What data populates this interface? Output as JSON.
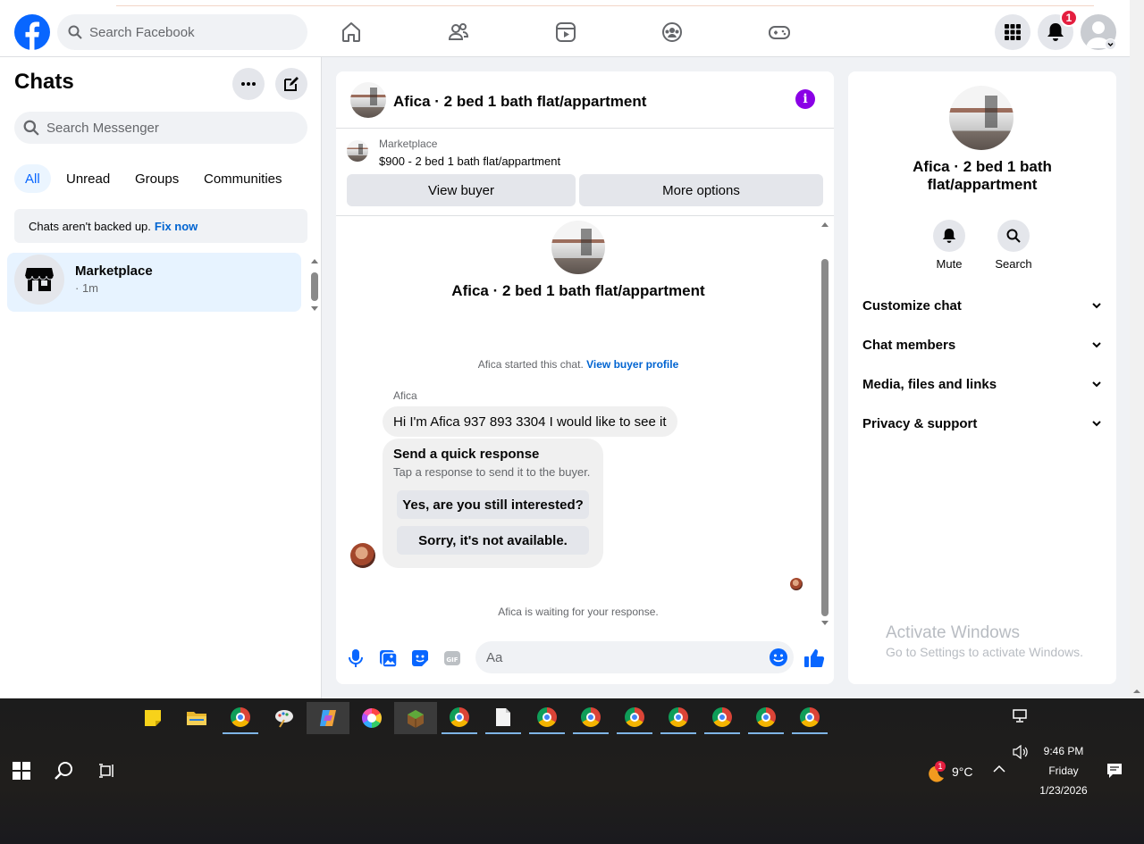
{
  "topbar": {
    "search_placeholder": "Search Facebook",
    "notification_count": "1",
    "nav_icons": [
      "home-icon",
      "friends-icon",
      "video-icon",
      "groups-icon",
      "gaming-icon"
    ]
  },
  "left": {
    "title": "Chats",
    "search_placeholder": "Search Messenger",
    "filters": [
      "All",
      "Unread",
      "Groups",
      "Communities"
    ],
    "active_filter": "All",
    "backup_text": "Chats aren't backed up.",
    "backup_link": "Fix now",
    "chat": {
      "name": "Marketplace",
      "time": "· 1m"
    }
  },
  "conversation": {
    "title": "Afica · 2 bed 1 bath flat/appartment",
    "listing_source": "Marketplace",
    "listing_detail": "$900 - 2 bed 1 bath flat/appartment",
    "view_buyer": "View buyer",
    "more_options": "More options",
    "intro_title": "Afica · 2 bed 1 bath flat/appartment",
    "started_text": "Afica started this chat.",
    "buyer_profile_link": "View buyer profile",
    "sender_name": "Afica",
    "message": "Hi I'm Afica 937 893 3304 I would like to see it",
    "quick_title": "Send a quick response",
    "quick_subtitle": "Tap a response to send it to the buyer.",
    "quick_options": [
      "Yes, are you still interested?",
      "Sorry, it's not available."
    ],
    "waiting_text": "Afica is waiting for your response.",
    "composer_placeholder": "Aa"
  },
  "details": {
    "title_line1": "Afica · 2 bed 1 bath",
    "title_line2": "flat/appartment",
    "mute": "Mute",
    "search": "Search",
    "sections": [
      "Customize chat",
      "Chat members",
      "Media, files and links",
      "Privacy & support"
    ],
    "watermark_title": "Activate Windows",
    "watermark_sub": "Go to Settings to activate Windows."
  },
  "taskbar": {
    "weather_temp": "9°C",
    "weather_badge": "1",
    "time": "9:46 PM",
    "day": "Friday",
    "date": "1/23/2026"
  },
  "colors": {
    "brand": "#0866ff",
    "accent_purple": "#8a00e6",
    "badge_red": "#e41e3f",
    "selected_chat": "#e7f3ff"
  }
}
